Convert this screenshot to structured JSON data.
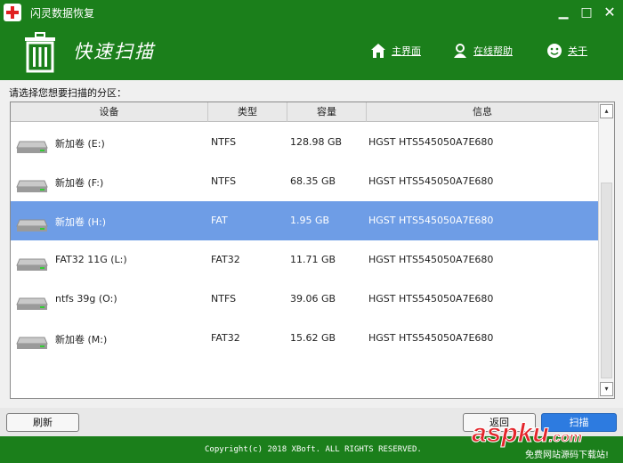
{
  "window": {
    "title": "闪灵数据恢复",
    "min": "▁",
    "max": "□",
    "close": "✕"
  },
  "header": {
    "title": "快速扫描",
    "nav": {
      "home": "主界面",
      "help": "在线帮助",
      "about": "关于"
    }
  },
  "prompt": "请选择您想要扫描的分区：",
  "table": {
    "columns": [
      "设备",
      "类型",
      "容量",
      "信息"
    ],
    "rows": [
      {
        "name": "新加卷 (E:)",
        "type": "NTFS",
        "capacity": "128.98 GB",
        "info": "HGST HTS545050A7E680"
      },
      {
        "name": "新加卷 (F:)",
        "type": "NTFS",
        "capacity": "68.35 GB",
        "info": "HGST HTS545050A7E680"
      },
      {
        "name": "新加卷 (H:)",
        "type": "FAT",
        "capacity": "1.95 GB",
        "info": "HGST HTS545050A7E680"
      },
      {
        "name": "FAT32 11G (L:)",
        "type": "FAT32",
        "capacity": "11.71 GB",
        "info": "HGST HTS545050A7E680"
      },
      {
        "name": "ntfs 39g (O:)",
        "type": "NTFS",
        "capacity": "39.06 GB",
        "info": "HGST HTS545050A7E680"
      },
      {
        "name": "新加卷 (M:)",
        "type": "FAT32",
        "capacity": "15.62 GB",
        "info": "HGST HTS545050A7E680"
      }
    ],
    "selected_index": 2
  },
  "scroll": {
    "up": "▴",
    "down": "▾"
  },
  "buttons": {
    "refresh": "刷新",
    "back": "返回",
    "scan": "扫描"
  },
  "footer": {
    "copyright": "Copyright(c) 2018 XBoft. ALL RIGHTS RESERVED."
  },
  "watermark": {
    "text": "aspku",
    "tld": ".com",
    "sub": "免费网站源码下载站!"
  },
  "colors": {
    "brand_green": "#1b7f1b",
    "selection": "#6e9de6",
    "scan_blue": "#2d7be0"
  }
}
